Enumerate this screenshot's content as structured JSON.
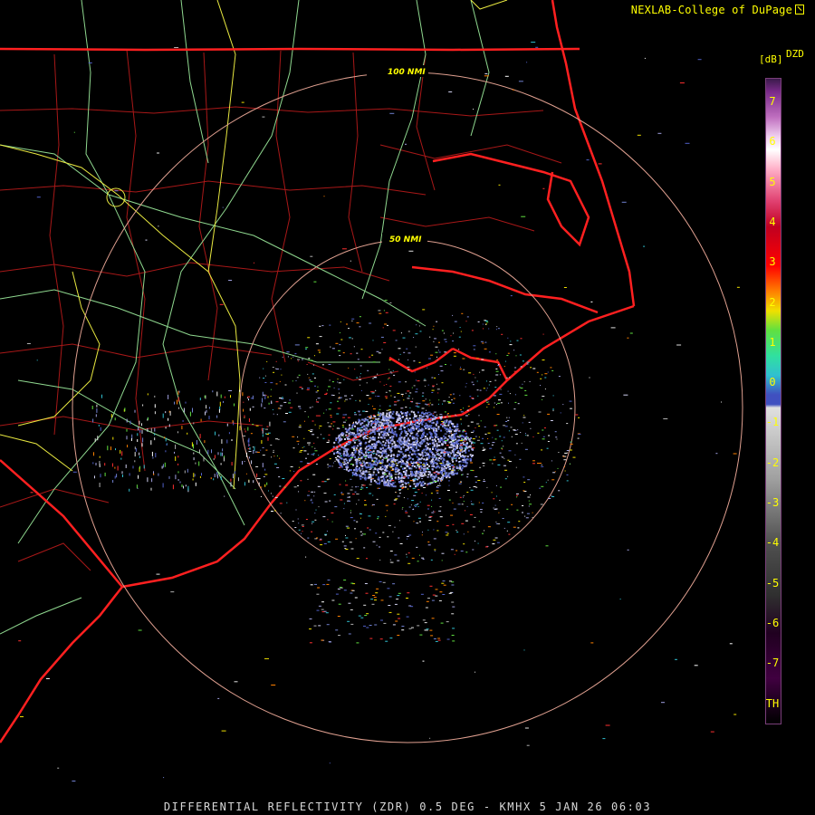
{
  "credit": "NEXLAB-College of DuPage",
  "product_title": "DIFFERENTIAL REFLECTIVITY (ZDR) 0.5 DEG - KMHX 5 JAN 26 06:03",
  "range_rings": [
    "50 NMI",
    "100 NMI"
  ],
  "scale": {
    "unit": "[dB]",
    "product": "DZD",
    "ticks": [
      "7",
      "6",
      "5",
      "4",
      "3",
      "2",
      "1",
      "0",
      "-1",
      "-2",
      "-3",
      "-4",
      "-5",
      "-6",
      "-7",
      "TH"
    ]
  },
  "colors": {
    "state_border": "#ff2020",
    "county_border": "#b01818",
    "highway_yellow": "#e8e840",
    "highway_green": "#90d890",
    "range_ring": "#e0a090",
    "label": "#ffff00"
  }
}
